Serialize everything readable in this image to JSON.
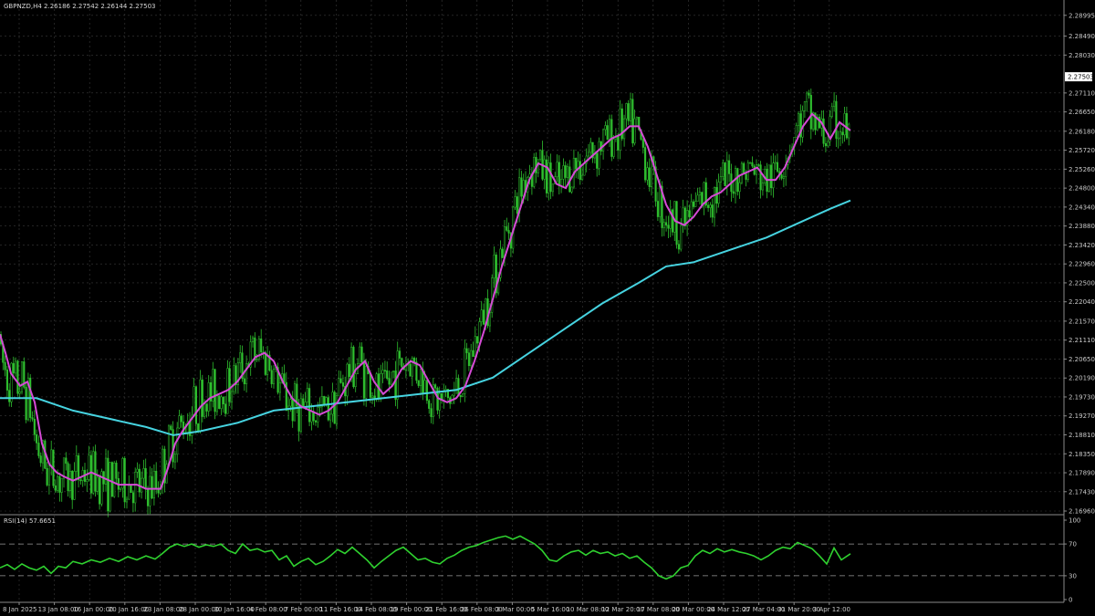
{
  "header": {
    "main": "GBPNZD,H4  2.26186 2.27542 2.26144 2.27503",
    "rsi": "RSI(14) 57.6651"
  },
  "colors": {
    "background": "#000000",
    "grid": "#3a3a3a",
    "candle": "#2fc12f",
    "ma_fast": "#d64ad6",
    "ma_slow": "#46d3e0",
    "rsi": "#2fd12f",
    "text": "#c8c8c8"
  },
  "chart_data": [
    {
      "type": "line",
      "ylim": [
        2.1696,
        2.2899
      ],
      "y_ticks": [
        "2.28995",
        "2.28490",
        "2.28030",
        "2.27503",
        "2.27110",
        "2.26650",
        "2.26180",
        "2.25720",
        "2.25260",
        "2.24800",
        "2.24340",
        "2.23880",
        "2.23420",
        "2.22960",
        "2.22500",
        "2.22040",
        "2.21570",
        "2.21110",
        "2.20650",
        "2.20190",
        "2.19730",
        "2.19270",
        "2.18810",
        "2.18350",
        "2.17890",
        "2.17430",
        "2.16960"
      ],
      "current_price": "2.27503",
      "x_ticks": [
        "8 Jan 2025",
        "13 Jan 08:00",
        "16 Jan 00:00",
        "20 Jan 16:00",
        "23 Jan 08:00",
        "28 Jan 00:00",
        "30 Jan 16:00",
        "4 Feb 08:00",
        "7 Feb 00:00",
        "11 Feb 16:00",
        "14 Feb 08:00",
        "19 Feb 00:00",
        "21 Feb 16:00",
        "26 Feb 08:00",
        "3 Mar 00:00",
        "5 Mar 16:00",
        "10 Mar 08:00",
        "12 Mar 20:00",
        "17 Mar 08:00",
        "20 Mar 00:00",
        "24 Mar 12:00",
        "27 Mar 04:00",
        "31 Mar 20:00",
        "3 Apr 12:00"
      ],
      "series": [
        {
          "points": [
            [
              0,
              2.2125
            ],
            [
              6,
              2.208
            ],
            [
              12,
              2.203
            ],
            [
              22,
              2.2
            ],
            [
              30,
              2.201
            ],
            [
              38,
              2.196
            ],
            [
              46,
              2.186
            ],
            [
              54,
              2.181
            ],
            [
              62,
              2.179
            ],
            [
              70,
              2.178
            ],
            [
              80,
              2.177
            ],
            [
              90,
              2.178
            ],
            [
              100,
              2.179
            ],
            [
              110,
              2.178
            ],
            [
              120,
              2.177
            ],
            [
              130,
              2.176
            ],
            [
              140,
              2.176
            ],
            [
              150,
              2.176
            ],
            [
              160,
              2.175
            ],
            [
              168,
              2.175
            ],
            [
              176,
              2.175
            ],
            [
              184,
              2.18
            ],
            [
              192,
              2.186
            ],
            [
              200,
              2.189
            ],
            [
              210,
              2.192
            ],
            [
              220,
              2.195
            ],
            [
              230,
              2.197
            ],
            [
              240,
              2.198
            ],
            [
              250,
              2.199
            ],
            [
              260,
              2.201
            ],
            [
              270,
              2.204
            ],
            [
              280,
              2.207
            ],
            [
              290,
              2.208
            ],
            [
              300,
              2.206
            ],
            [
              310,
              2.201
            ],
            [
              320,
              2.197
            ],
            [
              330,
              2.195
            ],
            [
              340,
              2.194
            ],
            [
              350,
              2.193
            ],
            [
              360,
              2.194
            ],
            [
              370,
              2.196
            ],
            [
              380,
              2.2
            ],
            [
              390,
              2.204
            ],
            [
              400,
              2.206
            ],
            [
              410,
              2.201
            ],
            [
              420,
              2.198
            ],
            [
              430,
              2.2
            ],
            [
              440,
              2.204
            ],
            [
              450,
              2.206
            ],
            [
              460,
              2.205
            ],
            [
              470,
              2.201
            ],
            [
              480,
              2.197
            ],
            [
              490,
              2.196
            ],
            [
              500,
              2.197
            ],
            [
              510,
              2.2
            ],
            [
              520,
              2.206
            ],
            [
              530,
              2.213
            ],
            [
              540,
              2.221
            ],
            [
              550,
              2.229
            ],
            [
              560,
              2.236
            ],
            [
              570,
              2.243
            ],
            [
              580,
              2.25
            ],
            [
              590,
              2.254
            ],
            [
              600,
              2.253
            ],
            [
              610,
              2.249
            ],
            [
              620,
              2.248
            ],
            [
              630,
              2.252
            ],
            [
              640,
              2.254
            ],
            [
              650,
              2.256
            ],
            [
              660,
              2.258
            ],
            [
              670,
              2.26
            ],
            [
              680,
              2.261
            ],
            [
              690,
              2.263
            ],
            [
              700,
              2.263
            ],
            [
              710,
              2.258
            ],
            [
              720,
              2.251
            ],
            [
              730,
              2.244
            ],
            [
              740,
              2.24
            ],
            [
              750,
              2.239
            ],
            [
              760,
              2.241
            ],
            [
              770,
              2.244
            ],
            [
              780,
              2.246
            ],
            [
              790,
              2.247
            ],
            [
              800,
              2.249
            ],
            [
              810,
              2.251
            ],
            [
              820,
              2.252
            ],
            [
              830,
              2.253
            ],
            [
              840,
              2.25
            ],
            [
              850,
              2.25
            ],
            [
              860,
              2.253
            ],
            [
              870,
              2.258
            ],
            [
              880,
              2.263
            ],
            [
              890,
              2.266
            ],
            [
              900,
              2.264
            ],
            [
              910,
              2.26
            ],
            [
              920,
              2.264
            ],
            [
              932,
              2.262
            ]
          ]
        },
        {
          "points": [
            [
              0,
              2.197
            ],
            [
              40,
              2.197
            ],
            [
              80,
              2.194
            ],
            [
              120,
              2.192
            ],
            [
              160,
              2.19
            ],
            [
              190,
              2.188
            ],
            [
              220,
              2.189
            ],
            [
              260,
              2.191
            ],
            [
              300,
              2.194
            ],
            [
              340,
              2.195
            ],
            [
              380,
              2.196
            ],
            [
              420,
              2.197
            ],
            [
              460,
              2.198
            ],
            [
              500,
              2.199
            ],
            [
              540,
              2.202
            ],
            [
              580,
              2.208
            ],
            [
              620,
              2.214
            ],
            [
              660,
              2.22
            ],
            [
              700,
              2.225
            ],
            [
              730,
              2.229
            ],
            [
              760,
              2.23
            ],
            [
              800,
              2.233
            ],
            [
              840,
              2.236
            ],
            [
              880,
              2.24
            ],
            [
              910,
              2.243
            ],
            [
              932,
              2.245
            ]
          ]
        }
      ]
    },
    {
      "type": "line",
      "title": "RSI(14) 57.6651",
      "ylim": [
        0,
        100
      ],
      "y_ticks": [
        "100",
        "70",
        "30",
        "0"
      ],
      "levels": [
        70,
        30
      ],
      "series": [
        {
          "points": [
            [
              0,
              40
            ],
            [
              8,
              44
            ],
            [
              16,
              38
            ],
            [
              24,
              45
            ],
            [
              32,
              40
            ],
            [
              40,
              37
            ],
            [
              48,
              42
            ],
            [
              56,
              33
            ],
            [
              64,
              42
            ],
            [
              72,
              40
            ],
            [
              80,
              48
            ],
            [
              90,
              45
            ],
            [
              100,
              50
            ],
            [
              110,
              47
            ],
            [
              120,
              52
            ],
            [
              130,
              48
            ],
            [
              140,
              54
            ],
            [
              150,
              50
            ],
            [
              160,
              55
            ],
            [
              170,
              51
            ],
            [
              178,
              58
            ],
            [
              186,
              66
            ],
            [
              194,
              70
            ],
            [
              202,
              67
            ],
            [
              210,
              70
            ],
            [
              218,
              66
            ],
            [
              226,
              69
            ],
            [
              234,
              67
            ],
            [
              242,
              70
            ],
            [
              250,
              62
            ],
            [
              258,
              58
            ],
            [
              266,
              70
            ],
            [
              274,
              62
            ],
            [
              282,
              64
            ],
            [
              290,
              60
            ],
            [
              298,
              62
            ],
            [
              306,
              50
            ],
            [
              314,
              55
            ],
            [
              322,
              42
            ],
            [
              330,
              48
            ],
            [
              338,
              52
            ],
            [
              346,
              44
            ],
            [
              354,
              48
            ],
            [
              362,
              55
            ],
            [
              370,
              63
            ],
            [
              378,
              58
            ],
            [
              386,
              66
            ],
            [
              394,
              58
            ],
            [
              402,
              50
            ],
            [
              410,
              40
            ],
            [
              418,
              48
            ],
            [
              426,
              55
            ],
            [
              434,
              62
            ],
            [
              442,
              66
            ],
            [
              450,
              58
            ],
            [
              458,
              50
            ],
            [
              466,
              52
            ],
            [
              474,
              47
            ],
            [
              482,
              45
            ],
            [
              490,
              52
            ],
            [
              498,
              56
            ],
            [
              506,
              62
            ],
            [
              514,
              66
            ],
            [
              522,
              68
            ],
            [
              530,
              72
            ],
            [
              538,
              75
            ],
            [
              546,
              78
            ],
            [
              554,
              80
            ],
            [
              562,
              76
            ],
            [
              570,
              80
            ],
            [
              578,
              75
            ],
            [
              586,
              70
            ],
            [
              594,
              62
            ],
            [
              602,
              50
            ],
            [
              610,
              48
            ],
            [
              618,
              55
            ],
            [
              626,
              60
            ],
            [
              634,
              62
            ],
            [
              642,
              56
            ],
            [
              650,
              62
            ],
            [
              658,
              58
            ],
            [
              666,
              60
            ],
            [
              674,
              55
            ],
            [
              682,
              58
            ],
            [
              690,
              52
            ],
            [
              698,
              55
            ],
            [
              706,
              47
            ],
            [
              714,
              40
            ],
            [
              722,
              30
            ],
            [
              730,
              26
            ],
            [
              738,
              30
            ],
            [
              746,
              40
            ],
            [
              754,
              43
            ],
            [
              762,
              55
            ],
            [
              770,
              62
            ],
            [
              778,
              58
            ],
            [
              786,
              64
            ],
            [
              794,
              60
            ],
            [
              802,
              63
            ],
            [
              810,
              60
            ],
            [
              818,
              58
            ],
            [
              826,
              55
            ],
            [
              834,
              50
            ],
            [
              842,
              55
            ],
            [
              850,
              62
            ],
            [
              858,
              66
            ],
            [
              866,
              64
            ],
            [
              874,
              72
            ],
            [
              882,
              68
            ],
            [
              890,
              64
            ],
            [
              898,
              55
            ],
            [
              906,
              45
            ],
            [
              914,
              65
            ],
            [
              922,
              50
            ],
            [
              932,
              57.7
            ]
          ]
        }
      ]
    }
  ]
}
